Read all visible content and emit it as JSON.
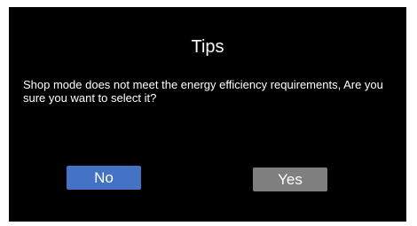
{
  "dialog": {
    "title": "Tips",
    "message": "Shop mode does not meet the energy efficiency requirements, Are you sure you want to select it?",
    "no_label": "No",
    "yes_label": "Yes"
  },
  "colors": {
    "background": "#000000",
    "no_button": "#4472c4",
    "yes_button": "#7f7f7f",
    "text": "#ffffff"
  }
}
